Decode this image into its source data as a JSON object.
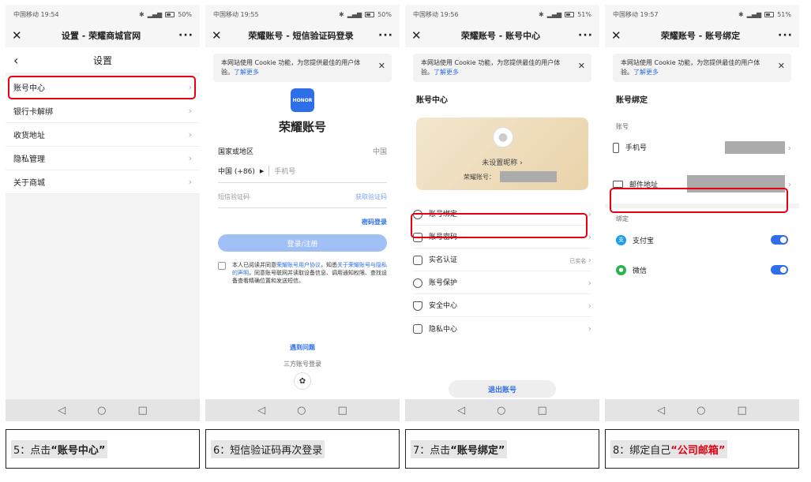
{
  "phone1": {
    "status_left": "中国移动 19:54",
    "status_right": "50%",
    "title": "设置 - 荣耀商城官网",
    "page_title": "设置",
    "items": [
      {
        "label": "账号中心"
      },
      {
        "label": "银行卡解绑"
      },
      {
        "label": "收货地址"
      },
      {
        "label": "隐私管理"
      },
      {
        "label": "关于商城"
      }
    ]
  },
  "phone2": {
    "status_left": "中国移动 19:55",
    "status_right": "50%",
    "title": "荣耀账号 - 短信验证码登录",
    "cookie_text": "本网站使用 Cookie 功能，为您提供最佳的用户体验。",
    "cookie_link": "了解更多",
    "logo_text": "HONOR",
    "brand": "荣耀账号",
    "region_label": "国家或地区",
    "region_value": "中国",
    "country_code": "中国 (+86)",
    "phone_placeholder": "手机号",
    "sms_placeholder": "短信验证码",
    "get_code": "获取验证码",
    "password_login": "密码登录",
    "login_button": "登录/注册",
    "agreement_a": "本人已阅读并同意",
    "agreement_link1": "荣耀账号用户协议",
    "agreement_b": "，知悉",
    "agreement_link2": "关于荣耀账号与隐私的声明",
    "agreement_c": "，同意账号联网并读取设备信息、调用通知权限、查找设备查看精确位置和发送短信。",
    "problem_link": "遇到问题",
    "third_party": "三方账号登录"
  },
  "phone3": {
    "status_left": "中国移动 19:56",
    "status_right": "51%",
    "title": "荣耀账号 - 账号中心",
    "cookie_text": "本网站使用 Cookie 功能，为您提供最佳的用户体验。",
    "cookie_link": "了解更多",
    "section_title": "账号中心",
    "nickname": "未设置昵称",
    "account_label": "荣耀账号：",
    "rows": [
      {
        "label": "账号绑定",
        "value": ""
      },
      {
        "label": "账号密码",
        "value": ""
      },
      {
        "label": "实名认证",
        "value": "已实名"
      },
      {
        "label": "账号保护",
        "value": ""
      },
      {
        "label": "安全中心",
        "value": ""
      },
      {
        "label": "隐私中心",
        "value": ""
      }
    ],
    "logout": "退出账号"
  },
  "phone4": {
    "status_left": "中国移动 19:57",
    "status_right": "51%",
    "title": "荣耀账号 - 账号绑定",
    "cookie_text": "本网站使用 Cookie 功能，为您提供最佳的用户体验。",
    "cookie_link": "了解更多",
    "section_title": "账号绑定",
    "account_section": "账号",
    "phone_label": "手机号",
    "email_label": "邮件地址",
    "bind_section": "绑定",
    "alipay": "支付宝",
    "wechat": "微信"
  },
  "captions": {
    "c1_prefix": "5：点击",
    "c1_strong": "“账号中心”",
    "c2": "6：短信验证码再次登录",
    "c3_prefix": "7：点击",
    "c3_strong": "“账号绑定”",
    "c4_prefix": "8：绑定自己",
    "c4_strong": "“公司邮箱”"
  },
  "colors": {
    "accent": "#2e6ee8",
    "highlight": "#e60012"
  }
}
